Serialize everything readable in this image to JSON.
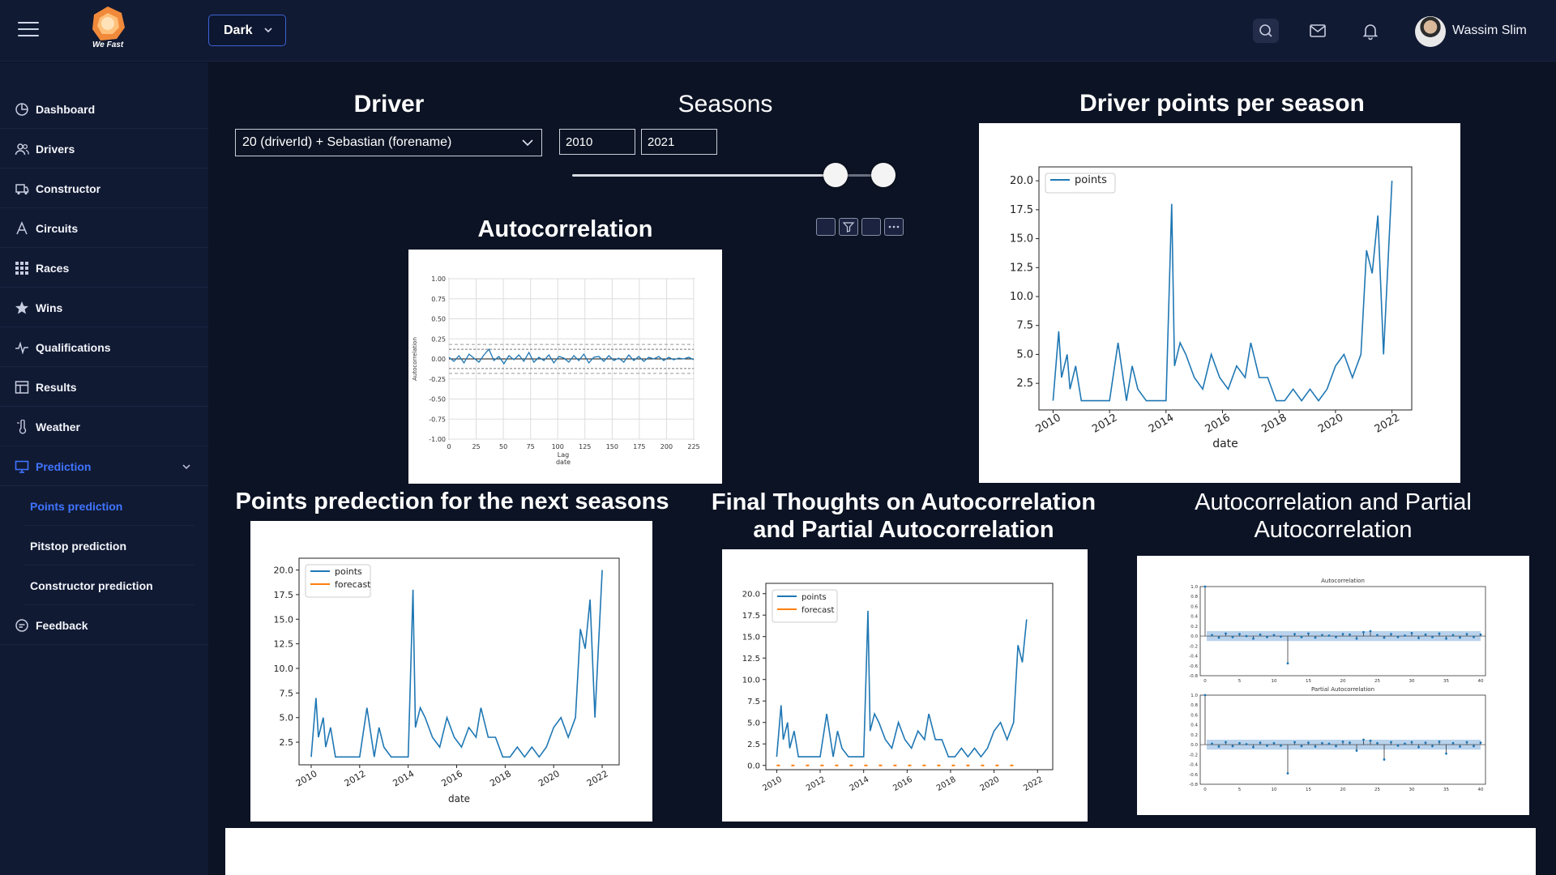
{
  "header": {
    "logo_text": "We Fast",
    "theme": "Dark",
    "user": {
      "name": "Wassim Slim"
    },
    "icons": [
      "menu-icon",
      "search-icon",
      "mail-icon",
      "bell-icon"
    ]
  },
  "sidebar": {
    "items": [
      {
        "label": "Dashboard",
        "icon": "dashboard-icon"
      },
      {
        "label": "Drivers",
        "icon": "users-icon"
      },
      {
        "label": "Constructor",
        "icon": "car-icon"
      },
      {
        "label": "Circuits",
        "icon": "circuit-icon"
      },
      {
        "label": "Races",
        "icon": "grid-icon"
      },
      {
        "label": "Wins",
        "icon": "star-icon"
      },
      {
        "label": "Qualifications",
        "icon": "pulse-icon"
      },
      {
        "label": "Results",
        "icon": "table-icon"
      },
      {
        "label": "Weather",
        "icon": "thermometer-icon"
      },
      {
        "label": "Prediction",
        "icon": "monitor-icon",
        "active": true
      },
      {
        "label": "Feedback",
        "icon": "feedback-icon"
      }
    ],
    "prediction_sub": [
      {
        "label": "Points prediction",
        "active": true
      },
      {
        "label": "Pitstop prediction"
      },
      {
        "label": "Constructor prediction"
      }
    ]
  },
  "filters": {
    "driver_title": "Driver",
    "driver_value": "20 (driverId) + Sebastian (forename)",
    "seasons_title": "Seasons",
    "season_from": "2010",
    "season_to": "2021",
    "slider_values": [
      2010,
      2021
    ]
  },
  "sections": {
    "autocorrelation": "Autocorrelation",
    "driver_points": "Driver points per season",
    "points_prediction": "Points predection for the next seasons",
    "final_thoughts": "Final Thoughts on Autocorrelation and Partial Autocorrelation",
    "acf_pacf": "Autocorrelation and Partial Autocorrelation"
  },
  "colors": {
    "accent": "#3f74ff",
    "bg": "#0c1324",
    "panel": "#111a33",
    "series_points": "#1f77b4",
    "series_forecast": "#ff7f0e",
    "ci_band": "#a9c8e8"
  },
  "chart_data": [
    {
      "id": "autocorr",
      "type": "line",
      "title": "",
      "xlabel": "Lag\ndate",
      "ylabel": "Autocorrelation",
      "xlim": [
        0,
        225
      ],
      "ylim": [
        -1.0,
        1.0
      ],
      "yticks": [
        "1.00",
        "0.75",
        "0.50",
        "0.25",
        "0.00",
        "-0.25",
        "-0.50",
        "-0.75",
        "-1.00"
      ],
      "xticks": [
        "0",
        "25",
        "50",
        "75",
        "100",
        "125",
        "150",
        "175",
        "200",
        "225"
      ],
      "grid": true,
      "series": [
        {
          "values": [
            0.02,
            -0.03,
            0.04,
            -0.05,
            0.06,
            0.01,
            -0.04,
            0.05,
            0.12,
            -0.02,
            0.03,
            -0.06,
            0.04,
            -0.01,
            0.05,
            -0.03,
            0.08,
            -0.04,
            0.02,
            -0.02,
            0.05,
            -0.05,
            0.03,
            0.01,
            -0.04,
            0.04,
            -0.02,
            0.06,
            -0.05,
            0.02,
            0.03,
            -0.03,
            0.04,
            -0.02,
            0.01,
            -0.04,
            0.05,
            -0.02,
            0.03,
            -0.03,
            0.02,
            0.0,
            0.03,
            -0.02,
            0.02,
            -0.01,
            0.01,
            0.0,
            0.02,
            -0.01
          ]
        }
      ]
    },
    {
      "id": "driver-points",
      "type": "line",
      "title": "",
      "xlabel": "date",
      "ylim": [
        0,
        20.0
      ],
      "yticks": [
        "2.5",
        "5.0",
        "7.5",
        "10.0",
        "12.5",
        "15.0",
        "17.5",
        "20.0"
      ],
      "xticks": [
        "2010",
        "2012",
        "2014",
        "2016",
        "2018",
        "2020",
        "2022"
      ],
      "legend": "top-left",
      "series": [
        {
          "name": "points",
          "x": [
            2010.0,
            2010.2,
            2010.3,
            2010.5,
            2010.6,
            2010.8,
            2011.0,
            2011.2,
            2011.5,
            2012.0,
            2012.3,
            2012.6,
            2012.8,
            2013.0,
            2013.3,
            2013.6,
            2014.0,
            2014.2,
            2014.3,
            2014.5,
            2014.7,
            2015.0,
            2015.3,
            2015.6,
            2015.9,
            2016.2,
            2016.5,
            2016.8,
            2017.0,
            2017.3,
            2017.6,
            2017.9,
            2018.2,
            2018.5,
            2018.8,
            2019.1,
            2019.4,
            2019.7,
            2020.0,
            2020.3,
            2020.6,
            2020.9,
            2021.1,
            2021.3,
            2021.5,
            2021.7,
            2022.0
          ],
          "values": [
            1,
            7,
            3,
            5,
            2,
            4,
            1,
            1,
            1,
            1,
            6,
            1,
            4,
            2,
            1,
            1,
            1,
            18,
            4,
            6,
            5,
            3,
            2,
            5,
            3,
            2,
            4,
            3,
            6,
            3,
            3,
            1,
            1,
            2,
            1,
            2,
            1,
            2,
            4,
            5,
            3,
            5,
            14,
            12,
            17,
            5,
            20
          ]
        }
      ]
    },
    {
      "id": "points-prediction",
      "type": "line",
      "title": "",
      "xlabel": "date",
      "ylim": [
        0,
        20.0
      ],
      "yticks": [
        "2.5",
        "5.0",
        "7.5",
        "10.0",
        "12.5",
        "15.0",
        "17.5",
        "20.0"
      ],
      "xticks": [
        "2010",
        "2012",
        "2014",
        "2016",
        "2018",
        "2020",
        "2022"
      ],
      "legend": "top-left",
      "series": [
        {
          "name": "points",
          "x": [
            2010.0,
            2010.2,
            2010.3,
            2010.5,
            2010.6,
            2010.8,
            2011.0,
            2011.2,
            2011.5,
            2012.0,
            2012.3,
            2012.6,
            2012.8,
            2013.0,
            2013.3,
            2013.6,
            2014.0,
            2014.2,
            2014.3,
            2014.5,
            2014.7,
            2015.0,
            2015.3,
            2015.6,
            2015.9,
            2016.2,
            2016.5,
            2016.8,
            2017.0,
            2017.3,
            2017.6,
            2017.9,
            2018.2,
            2018.5,
            2018.8,
            2019.1,
            2019.4,
            2019.7,
            2020.0,
            2020.3,
            2020.6,
            2020.9,
            2021.1,
            2021.3,
            2021.5,
            2021.7,
            2022.0
          ],
          "values": [
            1,
            7,
            3,
            5,
            2,
            4,
            1,
            1,
            1,
            1,
            6,
            1,
            4,
            2,
            1,
            1,
            1,
            18,
            4,
            6,
            5,
            3,
            2,
            5,
            3,
            2,
            4,
            3,
            6,
            3,
            3,
            1,
            1,
            2,
            1,
            2,
            1,
            2,
            4,
            5,
            3,
            5,
            14,
            12,
            17,
            5,
            20
          ]
        },
        {
          "name": "forecast",
          "x": [],
          "values": []
        }
      ]
    },
    {
      "id": "final-thoughts",
      "type": "line",
      "title": "",
      "xlabel": "",
      "ylim": [
        0,
        20.0
      ],
      "yticks": [
        "0.0",
        "2.5",
        "5.0",
        "7.5",
        "10.0",
        "12.5",
        "15.0",
        "17.5",
        "20.0"
      ],
      "xticks": [
        "2010",
        "2012",
        "2014",
        "2016",
        "2018",
        "2020",
        "2022"
      ],
      "legend": "top-left",
      "series": [
        {
          "name": "points",
          "x": [
            2010.0,
            2010.2,
            2010.3,
            2010.5,
            2010.6,
            2010.8,
            2011.0,
            2011.2,
            2011.5,
            2012.0,
            2012.3,
            2012.6,
            2012.8,
            2013.0,
            2013.3,
            2013.6,
            2014.0,
            2014.2,
            2014.3,
            2014.5,
            2014.7,
            2015.0,
            2015.3,
            2015.6,
            2015.9,
            2016.2,
            2016.5,
            2016.8,
            2017.0,
            2017.3,
            2017.6,
            2017.9,
            2018.2,
            2018.5,
            2018.8,
            2019.1,
            2019.4,
            2019.7,
            2020.0,
            2020.3,
            2020.6,
            2020.9,
            2021.1,
            2021.3,
            2021.5
          ],
          "values": [
            1,
            7,
            3,
            5,
            2,
            4,
            1,
            1,
            1,
            1,
            6,
            1,
            4,
            2,
            1,
            1,
            1,
            18,
            4,
            6,
            5,
            3,
            2,
            5,
            3,
            2,
            4,
            3,
            6,
            3,
            3,
            1,
            1,
            2,
            1,
            2,
            1,
            2,
            4,
            5,
            3,
            5,
            14,
            12,
            17
          ]
        },
        {
          "name": "forecast",
          "x": [
            2010.0,
            2011.0,
            2012.0,
            2013.0,
            2014.0,
            2015.0,
            2016.0,
            2017.0,
            2018.0,
            2019.0,
            2020.0,
            2020.5,
            2021.0
          ],
          "values": [
            0,
            0,
            0,
            0,
            0,
            0,
            0,
            0,
            0,
            0,
            0,
            0,
            0
          ]
        }
      ]
    },
    {
      "id": "acf",
      "type": "bar",
      "title": "Autocorrelation",
      "ylim": [
        -0.8,
        1.0
      ],
      "yticks": [
        "1.0",
        "0.8",
        "0.6",
        "0.4",
        "0.2",
        "0.0",
        "-0.2",
        "-0.4",
        "-0.6",
        "-0.8"
      ],
      "xticks": [
        "0",
        "5",
        "10",
        "15",
        "20",
        "25",
        "30",
        "35",
        "40"
      ],
      "values": [
        1.0,
        0.02,
        -0.03,
        0.05,
        -0.02,
        0.04,
        0.0,
        -0.05,
        0.03,
        -0.02,
        0.02,
        -0.01,
        -0.55,
        0.04,
        -0.02,
        0.05,
        -0.03,
        0.02,
        0.01,
        -0.02,
        0.04,
        0.03,
        -0.05,
        0.08,
        0.1,
        0.02,
        -0.03,
        0.04,
        -0.02,
        0.01,
        0.06,
        -0.04,
        0.03,
        -0.02,
        0.05,
        -0.05,
        0.02,
        -0.03,
        0.04,
        -0.02,
        0.03
      ]
    },
    {
      "id": "pacf",
      "type": "bar",
      "title": "Partial Autocorrelation",
      "ylim": [
        -0.8,
        1.0
      ],
      "yticks": [
        "1.0",
        "0.8",
        "0.6",
        "0.4",
        "0.2",
        "0.0",
        "-0.2",
        "-0.4",
        "-0.6",
        "-0.8"
      ],
      "xticks": [
        "0",
        "5",
        "10",
        "15",
        "20",
        "25",
        "30",
        "35",
        "40"
      ],
      "values": [
        1.0,
        0.02,
        -0.04,
        0.05,
        -0.03,
        0.03,
        0.01,
        -0.05,
        0.04,
        -0.02,
        0.03,
        -0.02,
        -0.58,
        0.05,
        -0.03,
        0.04,
        -0.04,
        0.03,
        0.02,
        -0.03,
        0.06,
        0.04,
        -0.12,
        0.1,
        0.08,
        0.03,
        -0.3,
        0.05,
        -0.02,
        0.02,
        0.05,
        -0.05,
        0.04,
        -0.03,
        0.06,
        -0.18,
        0.03,
        -0.04,
        0.05,
        -0.03,
        0.04
      ]
    }
  ]
}
